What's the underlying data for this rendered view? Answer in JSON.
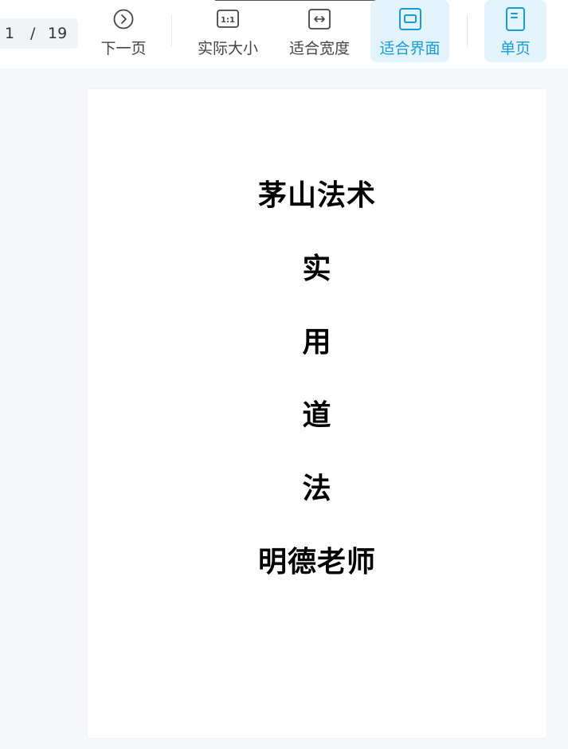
{
  "viewer": {
    "page_current": "1",
    "page_separator": "/",
    "page_total": "19",
    "accent_color": "#1a9bd7"
  },
  "toolbar": {
    "next_page": {
      "label": "下一页",
      "icon": "chevron-right-circle-icon"
    },
    "actual_size": {
      "label": "实际大小",
      "icon": "actual-size-icon",
      "icon_text": "1:1"
    },
    "fit_width": {
      "label": "适合宽度",
      "icon": "fit-width-icon"
    },
    "fit_page": {
      "label": "适合界面",
      "icon": "fit-page-icon",
      "active": true
    },
    "single_page": {
      "label": "单页",
      "icon": "single-page-icon",
      "active": true
    }
  },
  "document": {
    "lines": [
      "茅山法术",
      "实",
      "用",
      "道",
      "法",
      "明德老师"
    ]
  }
}
